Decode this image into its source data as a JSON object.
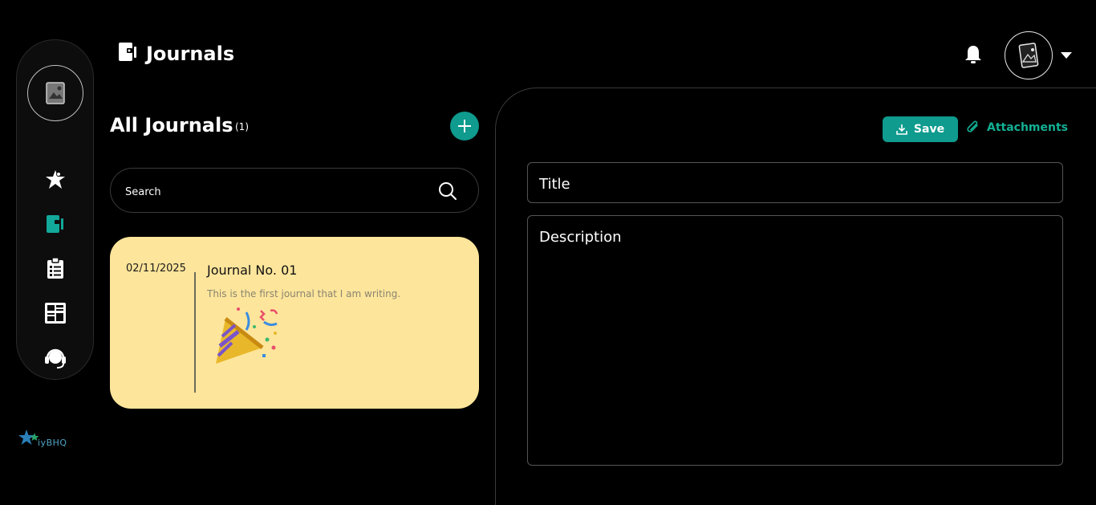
{
  "header": {
    "title": "Journals",
    "icons": [
      "journal-icon",
      "bell-icon",
      "user-avatar",
      "caret-down-icon"
    ]
  },
  "sidebar": {
    "items": [
      {
        "name": "dashboard",
        "icon": "star-person-icon"
      },
      {
        "name": "journals",
        "icon": "journal-icon",
        "active": true
      },
      {
        "name": "tasks",
        "icon": "clipboard-icon"
      },
      {
        "name": "vision-board",
        "icon": "gallery-icon"
      },
      {
        "name": "support",
        "icon": "headset-icon"
      }
    ],
    "brand": "iyBHQ"
  },
  "journals_list": {
    "title": "All Journals",
    "count": "(1)",
    "search_placeholder": "Search",
    "entries": [
      {
        "date": "02/11/2025",
        "title": "Journal No. 01",
        "description": "This is the first journal that I am writing.",
        "image": "party-popper-icon"
      }
    ]
  },
  "editor": {
    "save_label": "Save",
    "attachments_label": "Attachments",
    "title_placeholder": "Title",
    "description_placeholder": "Description"
  },
  "colors": {
    "accent": "#0f9b8e",
    "card": "#fde59b",
    "background": "#000000"
  }
}
